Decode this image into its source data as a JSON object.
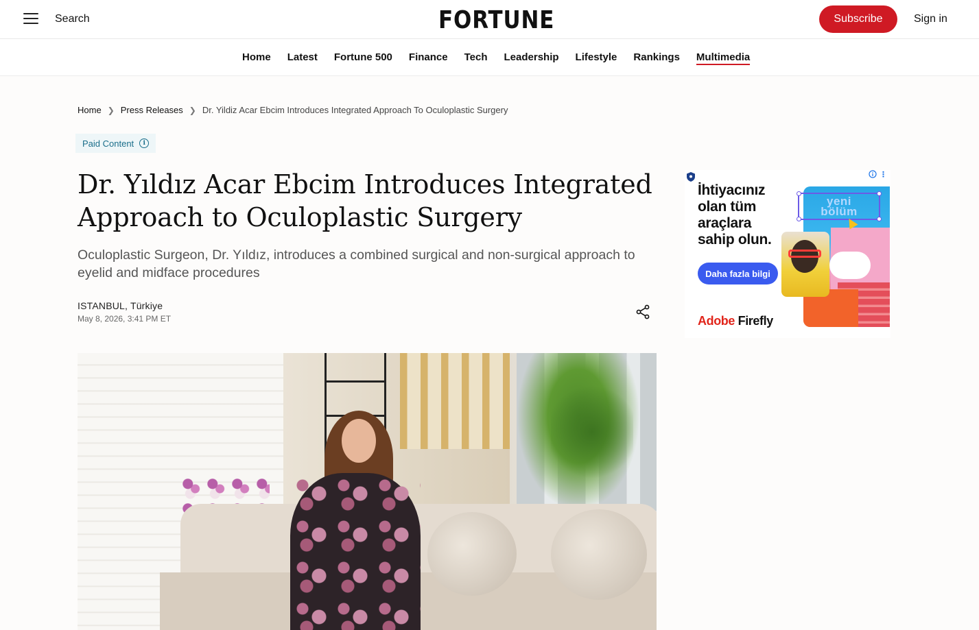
{
  "header": {
    "search_label": "Search",
    "logo": "FORTUNE",
    "subscribe_label": "Subscribe",
    "signin_label": "Sign in"
  },
  "nav": {
    "items": [
      {
        "label": "Home"
      },
      {
        "label": "Latest"
      },
      {
        "label": "Fortune 500"
      },
      {
        "label": "Finance"
      },
      {
        "label": "Tech"
      },
      {
        "label": "Leadership"
      },
      {
        "label": "Lifestyle"
      },
      {
        "label": "Rankings"
      },
      {
        "label": "Multimedia",
        "active": true
      }
    ]
  },
  "breadcrumb": {
    "home": "Home",
    "section": "Press Releases",
    "current": "Dr. Yildiz Acar Ebcim Introduces Integrated Approach To Oculoplastic Surgery"
  },
  "article": {
    "badge": "Paid Content",
    "headline": "Dr. Yıldız Acar Ebcim Introduces Integrated Approach to Oculoplastic Surgery",
    "dek": "Oculoplastic Surgeon, Dr. Yıldız, introduces a combined surgical and non-surgical approach to eyelid and midface procedures",
    "dateline": "ISTANBUL, Türkiye",
    "timestamp": "May 8, 2026, 3:41 PM ET"
  },
  "ad": {
    "headline": "İhtiyacınız olan tüm araçlara sahip olun.",
    "cta": "Daha fazla bilgi",
    "brand_adobe": "Adobe",
    "brand_product": "Firefly",
    "tag_line1": "yeni",
    "tag_line2": "bölüm"
  },
  "colors": {
    "accent": "#cf1a24",
    "paid_badge_bg": "#eef6f8",
    "paid_badge_text": "#1a6e8a",
    "ad_cta": "#3a5bef"
  },
  "icons": [
    "menu-icon",
    "chevron-right-icon",
    "info-icon",
    "share-icon",
    "ad-choices-icon",
    "shield-icon"
  ]
}
